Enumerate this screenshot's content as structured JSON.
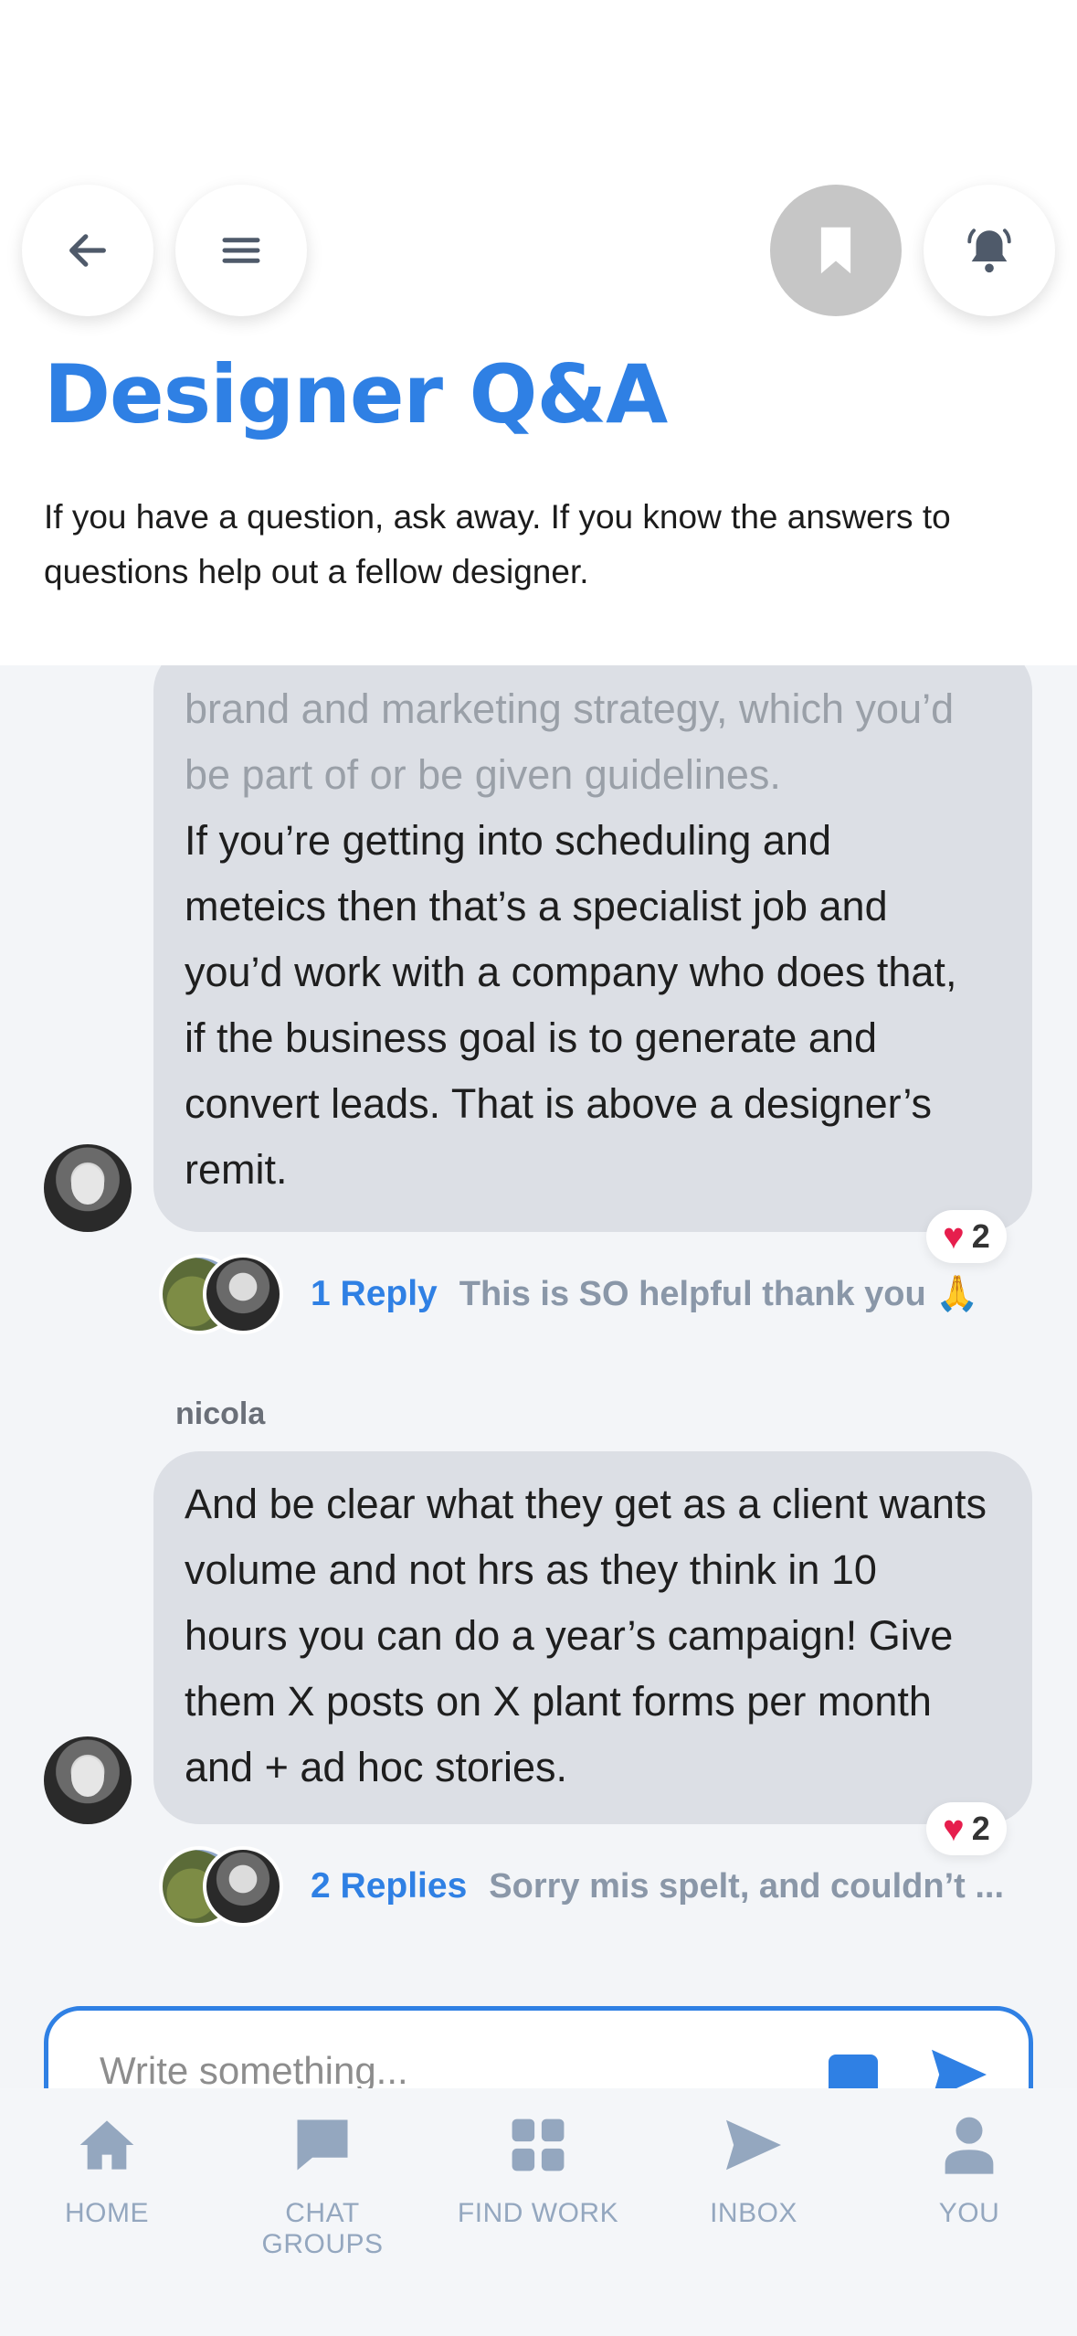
{
  "header": {
    "title": "Designer Q&A",
    "description": "If you have a question, ask away. If you know the answers to questions help out a fellow designer."
  },
  "posts": [
    {
      "faded_text": "brand and marketing strategy, which you’d be part of or be given guidelines.",
      "text_lines": [
        "If you’re getting into scheduling and",
        "meteics then that’s a specialist job and",
        "you’d work with a company who does that,",
        "if the business goal is to generate and",
        "convert leads. That is above a designer’s",
        "remit."
      ],
      "reaction_count": "2",
      "reply_count_label": "1 Reply",
      "reply_preview": "This is SO helpful thank you 🙏"
    },
    {
      "author": "nicola",
      "text_lines": [
        "And be clear what they get as a client wants",
        "volume and not hrs as they think in 10",
        "hours you can do a year’s campaign! Give",
        "them X posts on X plant forms per month",
        "and + ad hoc stories."
      ],
      "reaction_count": "2",
      "reply_count_label": "2 Replies",
      "reply_preview": "Sorry mis spelt, and couldn’t ..."
    }
  ],
  "composer": {
    "placeholder": "Write something..."
  },
  "tabs": [
    {
      "label": "HOME",
      "icon": "home-icon"
    },
    {
      "label": "CHAT GROUPS",
      "icon": "chat-icon"
    },
    {
      "label": "FIND WORK",
      "icon": "grid-icon"
    },
    {
      "label": "INBOX",
      "icon": "send-icon"
    },
    {
      "label": "YOU",
      "icon": "person-icon"
    }
  ],
  "colors": {
    "accent": "#2f80e4",
    "tab_inactive": "#94a7bf",
    "bubble": "#dcdfe5",
    "heart": "#e61e4d"
  }
}
